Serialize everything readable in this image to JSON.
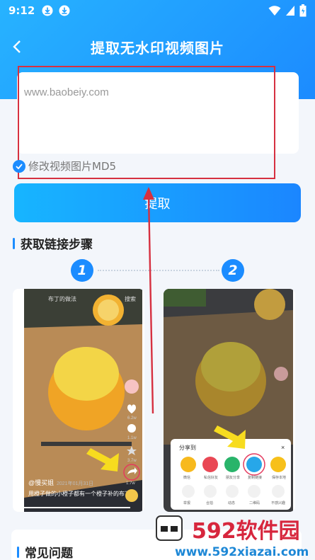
{
  "status": {
    "time": "9:12"
  },
  "header": {
    "title": "提取无水印视频图片"
  },
  "input": {
    "value": "www.baobeiy.com"
  },
  "md5": {
    "label": "修改视频图片MD5"
  },
  "extract": {
    "label": "提取"
  },
  "steps": {
    "title": "获取链接步骤",
    "labels": [
      "1",
      "2"
    ]
  },
  "faq": {
    "title": "常见问题"
  },
  "screenshot1": {
    "top_text": "布丁的做法",
    "top_right": "搜索",
    "username": "@慢买姐",
    "date": "2021年01月31日",
    "caption": "用橙子做的小橙子都有一个橙子补的布丁",
    "counts": [
      "6.2w",
      "1.1w",
      "3.7w",
      "1.7w"
    ]
  },
  "screenshot2": {
    "share_title": "分享到",
    "row1": [
      "微信",
      "私信好友",
      "朋友分享",
      "复制链接",
      "保存本地"
    ],
    "row2": [
      "举报",
      "合拍",
      "动态",
      "二维码",
      "不感兴趣"
    ]
  },
  "watermark": {
    "text": "592软件园",
    "url": "www.592xiazai.com"
  },
  "colors": {
    "accent": "#1b8cff",
    "highlight": "#d63040"
  }
}
